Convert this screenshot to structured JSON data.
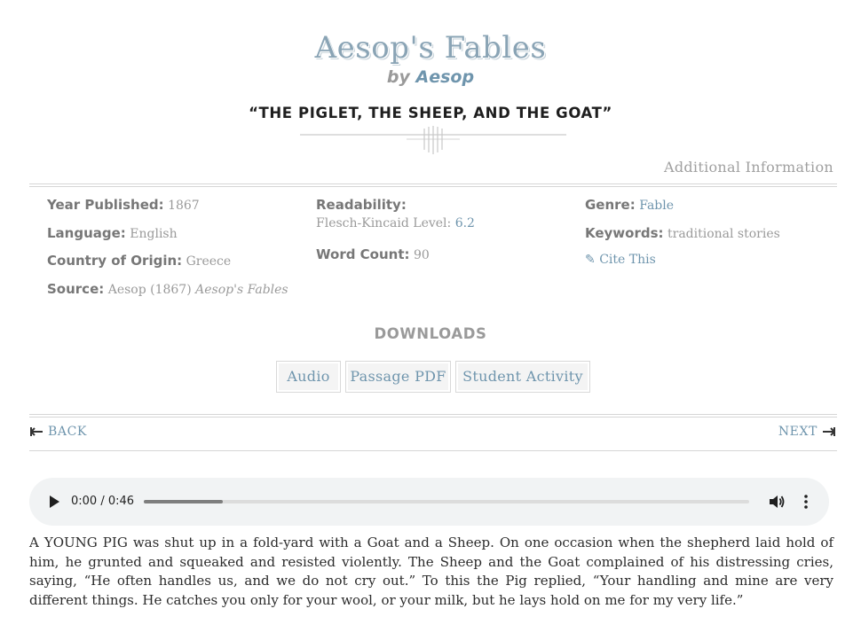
{
  "book": {
    "title": "Aesop's Fables",
    "by": "by",
    "author": "Aesop"
  },
  "story_title": "“THE PIGLET, THE SHEEP, AND THE GOAT”",
  "additional_info_label": "Additional Information",
  "meta": {
    "year_label": "Year Published:",
    "year_value": "1867",
    "language_label": "Language:",
    "language_value": "English",
    "country_label": "Country of Origin:",
    "country_value": "Greece",
    "source_label": "Source:",
    "source_value": "Aesop (1867)",
    "source_title": "Aesop's Fables",
    "readability_label": "Readability:",
    "fk_label": "Flesch-Kincaid Level:",
    "fk_value": "6.2",
    "wordcount_label": "Word Count:",
    "wordcount_value": "90",
    "genre_label": "Genre:",
    "genre_value": "Fable",
    "keywords_label": "Keywords:",
    "keywords_value": "traditional stories",
    "cite_icon": "✎",
    "cite_label": "Cite This"
  },
  "downloads": {
    "heading": "DOWNLOADS",
    "buttons": [
      "Audio",
      "Passage PDF",
      "Student Activity"
    ]
  },
  "nav": {
    "back": "BACK",
    "next": "NEXT"
  },
  "audio": {
    "time": "0:00 / 0:46",
    "buffered_fraction": 0.13
  },
  "passage": "A YOUNG PIG was shut up in a fold-yard with a Goat and a Sheep. On one occasion when the shepherd laid hold of him, he grunted and squeaked and resisted violently. The Sheep and the Goat complained of his distressing cries, saying, “He often handles us, and we do not cry out.” To this the Pig replied, “Your handling and mine are very different things. He catches you only for your wool, or your milk, but he lays hold on me for my very life.”",
  "colors": {
    "link": "#6f95ad",
    "title": "#8aa4b5",
    "muted": "#9a9a9a"
  }
}
